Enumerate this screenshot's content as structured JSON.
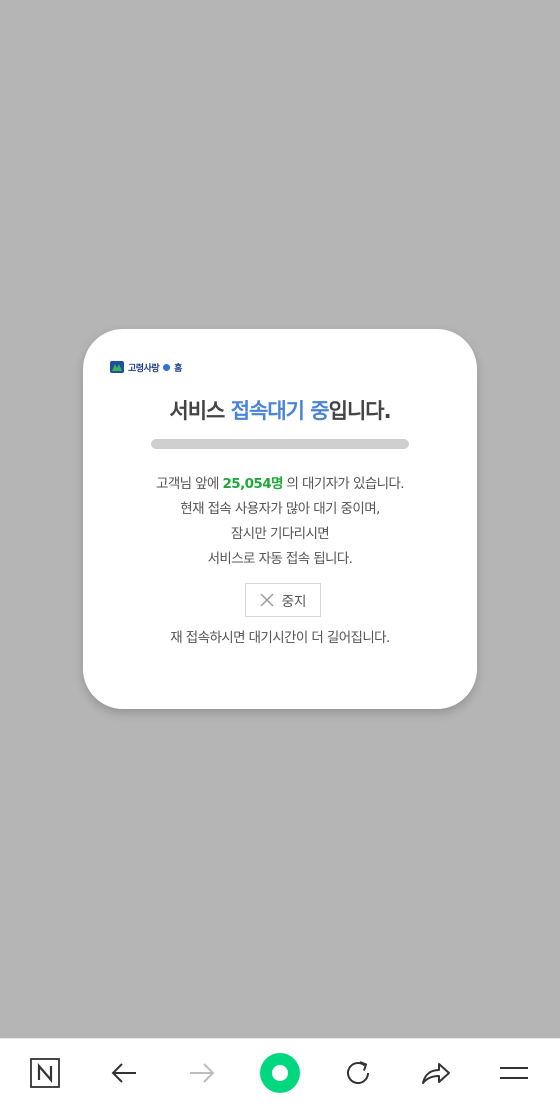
{
  "dialog": {
    "logo_text": "고령사랑",
    "logo_suffix": "홈",
    "title_prefix": "서비스 ",
    "title_highlight": "접속대기 중",
    "title_suffix": "입니다.",
    "progress": 0,
    "line1_prefix": "고객님 앞에 ",
    "wait_count": "25,054명",
    "line1_suffix": " 의 대기자가 있습니다.",
    "line2": "현재 접속 사용자가 많아 대기 중이며,",
    "line3": "잠시만 기다리시면",
    "line4": "서비스로 자동 접속 됩니다.",
    "stop_label": "중지",
    "note": "재 접속하시면 대기시간이 더 길어집니다."
  },
  "colors": {
    "accent": "#4a84d6",
    "count": "#1fa83a",
    "background": "#b5b5b5",
    "home_button": "#00d880"
  },
  "toolbar": {
    "icons": [
      "naver-n-icon",
      "back-arrow-icon",
      "forward-arrow-icon",
      "home-circle-icon",
      "refresh-icon",
      "share-icon",
      "menu-icon"
    ]
  }
}
